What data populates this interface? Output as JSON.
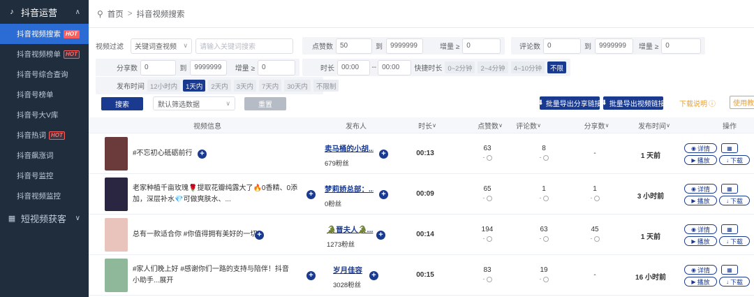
{
  "sidebar": {
    "group1": {
      "label": "抖音运营",
      "icon": "tiktok-icon"
    },
    "items": [
      {
        "label": "抖音视频搜索",
        "hot": "HOT",
        "active": true
      },
      {
        "label": "抖音视频榜单",
        "hot": "HOT",
        "active": false
      },
      {
        "label": "抖音号综合查询",
        "hot": "",
        "active": false
      },
      {
        "label": "抖音号榜单",
        "hot": "",
        "active": false
      },
      {
        "label": "抖音号大V库",
        "hot": "",
        "active": false
      },
      {
        "label": "抖音热词",
        "hot": "HOT",
        "active": false
      },
      {
        "label": "抖音飙涨词",
        "hot": "",
        "active": false
      },
      {
        "label": "抖音号监控",
        "hot": "",
        "active": false
      },
      {
        "label": "抖音视频监控",
        "hot": "",
        "active": false
      }
    ],
    "group2": {
      "label": "短视频获客"
    }
  },
  "breadcrumb": {
    "home": "首页",
    "current": "抖音视频搜索"
  },
  "filters": {
    "video_filter_label": "视频过滤",
    "keyword_mode": "关键词查视频",
    "search_placeholder": "请输入关键词搜索",
    "likes_label": "点赞数",
    "likes_min": "50",
    "to": "到",
    "likes_max": "9999999",
    "increment_label": "增量 ≥",
    "likes_inc": "0",
    "comments_label": "评论数",
    "comments_min": "0",
    "comments_max": "9999999",
    "comments_inc": "0",
    "shares_label": "分享数",
    "shares_min": "0",
    "shares_max": "9999999",
    "shares_inc": "0",
    "duration_label": "时长",
    "duration_min": "00:00",
    "duration_dash": "--",
    "duration_max": "00:00",
    "quick_duration_label": "快捷时长",
    "quick_duration": [
      "0~2分钟",
      "2~4分钟",
      "4~10分钟",
      "不限"
    ],
    "publish_time_label": "发布时间",
    "publish_time": [
      "12小时内",
      "1天内",
      "2天内",
      "3天内",
      "7天内",
      "30天内",
      "不限制"
    ]
  },
  "actions": {
    "search": "搜索",
    "default_filter": "默认筛选数据",
    "reset": "重置",
    "export_share": "批量导出分享链接",
    "export_video": "批量导出视频链接",
    "download_help": "下载说明",
    "tutorial": "使用教"
  },
  "table": {
    "headers": {
      "video": "视频信息",
      "publisher": "发布人",
      "duration": "时长",
      "likes": "点赞数",
      "comments": "评论数",
      "shares": "分享数",
      "publish_time": "发布时间",
      "ops": "操作"
    },
    "op_labels": {
      "detail": "详情",
      "play": "播放",
      "download": "下载"
    },
    "rows": [
      {
        "title": "#不忘初心砥砺前行",
        "publisher": "卖马桶的小胡...",
        "fans": "679粉丝",
        "duration": "00:13",
        "likes": "63",
        "likes_d": "-",
        "comments": "8",
        "comments_d": "-",
        "shares": "-",
        "time": "1 天前",
        "thumb_color": "#6b3a3a"
      },
      {
        "title": "老家种植千亩玫瑰🌹提取花瓣纯露大了🔥0香精、0添加，深层补水💎可做爽肤水、...",
        "publisher": "梦莉娇总部：...",
        "fans": "0粉丝",
        "duration": "00:09",
        "likes": "65",
        "likes_d": "-",
        "comments": "1",
        "comments_d": "-",
        "shares": "1",
        "shares_d": "-",
        "time": "3 小时前",
        "thumb_color": "#2a2540"
      },
      {
        "title": "总有一款适合你 #你值得拥有美好的一切",
        "publisher": "🐊晋夫人🐊...",
        "fans": "1273粉丝",
        "duration": "00:14",
        "likes": "194",
        "likes_d": "-",
        "comments": "63",
        "comments_d": "-",
        "shares": "45",
        "shares_d": "-",
        "time": "1 天前",
        "thumb_color": "#e8c4bc"
      },
      {
        "title": "#家人们晚上好 #感谢你们一路的支持与陪伴！抖音小助手...展开",
        "publisher": "岁月佳容",
        "fans": "3028粉丝",
        "duration": "00:15",
        "likes": "83",
        "likes_d": "-",
        "comments": "19",
        "comments_d": "-",
        "shares": "-",
        "time": "16 小时前",
        "thumb_color": "#8fb79a"
      }
    ]
  }
}
